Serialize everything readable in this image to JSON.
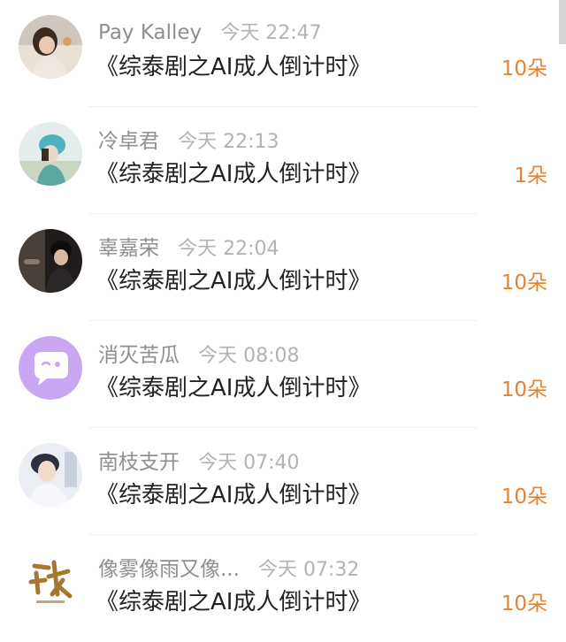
{
  "items": [
    {
      "name": "Pay Kalley",
      "time": "今天 22:47",
      "title": "《综泰剧之AI成人倒计时》",
      "count": "10朵",
      "avatar": "photo-woman-icon"
    },
    {
      "name": "冷卓君",
      "time": "今天 22:13",
      "title": "《综泰剧之AI成人倒计时》",
      "count": "1朵",
      "avatar": "photo-teal-icon"
    },
    {
      "name": "辜嘉荣",
      "time": "今天 22:04",
      "title": "《综泰剧之AI成人倒计时》",
      "count": "10朵",
      "avatar": "photo-dark-icon"
    },
    {
      "name": "消灭苦瓜",
      "time": "今天 08:08",
      "title": "《综泰剧之AI成人倒计时》",
      "count": "10朵",
      "avatar": "chat-bubble-icon"
    },
    {
      "name": "南枝支开",
      "time": "今天 07:40",
      "title": "《综泰剧之AI成人倒计时》",
      "count": "10朵",
      "avatar": "photo-man-icon"
    },
    {
      "name": "像雾像雨又像...",
      "time": "今天 07:32",
      "title": "《综泰剧之AI成人倒计时》",
      "count": "10朵",
      "avatar": "calligraphy-logo-icon"
    }
  ]
}
